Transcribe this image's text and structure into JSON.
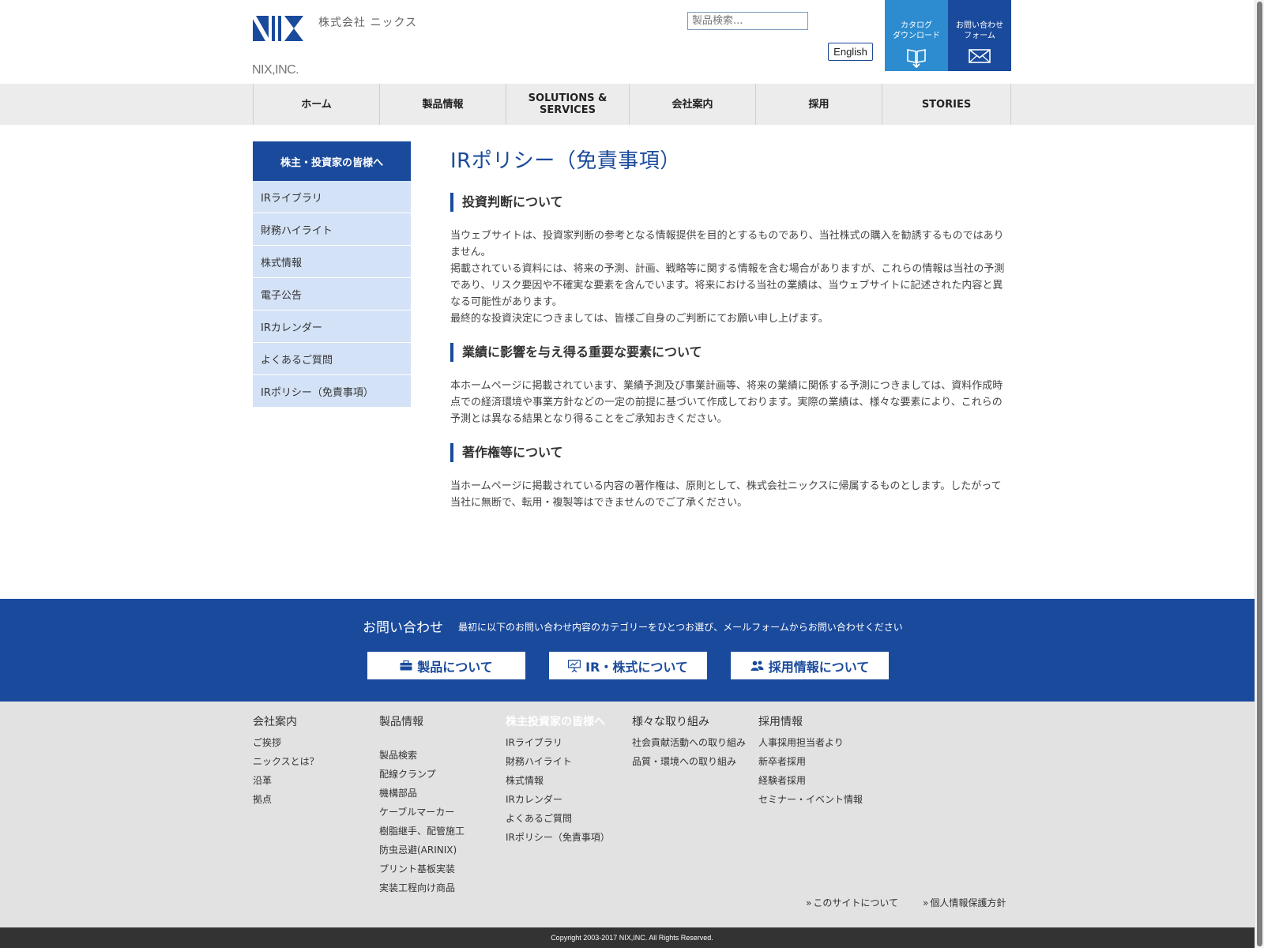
{
  "header": {
    "company_jp": "株式会社 ニックス",
    "company_en": "NIX,INC.",
    "search_placeholder": "製品検索...",
    "english_label": "English",
    "catalog_label": "カタログ\nダウンロード",
    "contact_form_label": "お問い合わせ\nフォーム"
  },
  "nav": {
    "items": [
      {
        "label": "ホーム"
      },
      {
        "label": "製品情報"
      },
      {
        "label": "SOLUTIONS &\nSERVICES"
      },
      {
        "label": "会社案内"
      },
      {
        "label": "採用"
      },
      {
        "label": "STORIES"
      }
    ]
  },
  "sidebar": {
    "heading": "株主・投資家の皆様へ",
    "items": [
      {
        "label": "IRライブラリ"
      },
      {
        "label": "財務ハイライト"
      },
      {
        "label": "株式情報"
      },
      {
        "label": "電子公告"
      },
      {
        "label": "IRカレンダー"
      },
      {
        "label": "よくあるご質問"
      },
      {
        "label": "IRポリシー（免責事項）"
      }
    ]
  },
  "main": {
    "title": "IRポリシー（免責事項）",
    "sections": [
      {
        "heading": "投資判断について",
        "paragraphs": [
          "当ウェブサイトは、投資家判断の参考となる情報提供を目的とするものであり、当社株式の購入を勧誘するものではありません。",
          "掲載されている資料には、将来の予測、計画、戦略等に関する情報を含む場合がありますが、これらの情報は当社の予測であり、リスク要因や不確実な要素を含んでいます。将来における当社の業績は、当ウェブサイトに記述された内容と異なる可能性があります。",
          "最終的な投資決定につきましては、皆様ご自身のご判断にてお願い申し上げます。"
        ]
      },
      {
        "heading": "業績に影響を与え得る重要な要素について",
        "paragraphs": [
          "本ホームページに掲載されています、業績予測及び事業計画等、将来の業績に関係する予測につきましては、資料作成時点での経済環境や事業方針などの一定の前提に基づいて作成しております。実際の業績は、様々な要素により、これらの予測とは異なる結果となり得ることをご承知おきください。"
        ]
      },
      {
        "heading": "著作権等について",
        "paragraphs": [
          "当ホームページに掲載されている内容の著作権は、原則として、株式会社ニックスに帰属するものとします。したがって当社に無断で、転用・複製等はできませんのでご了承ください。"
        ]
      }
    ]
  },
  "contact": {
    "title": "お問い合わせ",
    "description": "最初に以下のお問い合わせ内容のカテゴリーをひとつお選び、メールフォームからお問い合わせください",
    "buttons": [
      {
        "label": "製品について",
        "icon": "briefcase-icon"
      },
      {
        "label": "IR・株式について",
        "icon": "presentation-icon"
      },
      {
        "label": "採用情報について",
        "icon": "people-icon"
      }
    ]
  },
  "footer": {
    "columns": [
      {
        "heading": "会社案内",
        "links": [
          "ご挨拶",
          "ニックスとは？",
          "沿革",
          "拠点"
        ]
      },
      {
        "heading": "製品情報",
        "links": [
          "製品検索",
          "配線クランプ",
          "機構部品",
          "ケーブルマーカー",
          "樹脂継手、配管施工",
          "防虫忌避(ARINIX)",
          "プリント基板実装",
          "実装工程向け商品"
        ]
      },
      {
        "heading": "株主投資家の皆様へ",
        "links": [
          "IRライブラリ",
          "財務ハイライト",
          "株式情報",
          "IRカレンダー",
          "よくあるご質問",
          "IRポリシー（免責事項）"
        ]
      },
      {
        "heading": "様々な取り組み",
        "links": [
          "社会貢献活動への取り組み",
          "品質・環境への取り組み"
        ]
      },
      {
        "heading": "採用情報",
        "links": [
          "人事採用担当者より",
          "新卒者採用",
          "経験者採用",
          "セミナー・イベント情報"
        ]
      }
    ],
    "bottom_links": [
      "このサイトについて",
      "個人情報保護方針"
    ],
    "copyright": "Copyright 2003-2017 NIX,INC. All Rights Reserved."
  },
  "colors": {
    "brand_blue": "#1a4a9c",
    "catalog_blue": "#2d8ccf",
    "sidebar_item_bg": "#d3e2f6",
    "footer_bg": "#e2e2e2"
  }
}
